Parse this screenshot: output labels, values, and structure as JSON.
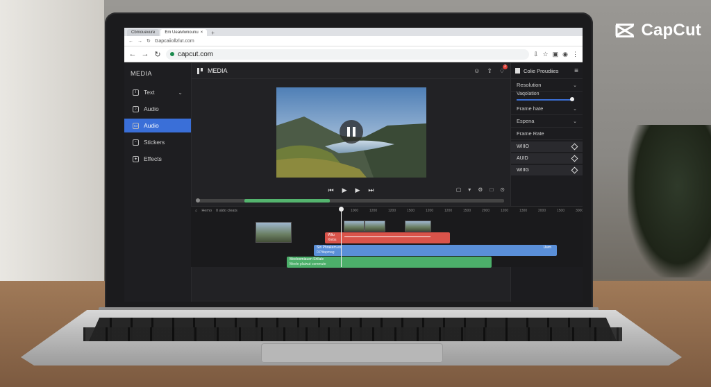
{
  "brand": {
    "name": "CapCut"
  },
  "browser": {
    "tabs": [
      {
        "label": "Cbmouevure"
      },
      {
        "label": "Em Ueaivlwnounu"
      }
    ],
    "url": "capcut.com",
    "second_bar_text": "Gapcaiiollzlut.com"
  },
  "left_panel": {
    "title": "MEDIA",
    "items": [
      {
        "label": "Text",
        "icon": "text-icon",
        "active": false
      },
      {
        "label": "Audio",
        "icon": "audio-icon",
        "active": false
      },
      {
        "label": "Audio",
        "icon": "audio-icon",
        "active": true
      },
      {
        "label": "Stickers",
        "icon": "stickers-icon",
        "active": false
      },
      {
        "label": "Effects",
        "icon": "effects-icon",
        "active": false
      }
    ]
  },
  "center": {
    "title": "MEDIA",
    "notification_count": "2"
  },
  "right_panel": {
    "title": "Colie Proudiies",
    "rows": [
      {
        "label": "Resolution"
      },
      {
        "label": "Vaqolation"
      },
      {
        "label": "Frame hate"
      },
      {
        "label": "Espena"
      },
      {
        "label": "Frame Rate"
      }
    ],
    "items": [
      {
        "label": "WIIIO"
      },
      {
        "label": "AUID"
      },
      {
        "label": "WIIIG"
      }
    ]
  },
  "timeline": {
    "head_left": "Hemo",
    "head_info": "0 aldo cleats",
    "ruler": [
      "1000",
      "1200",
      "1200",
      "1500",
      "1200",
      "1200",
      "1500",
      "2000",
      "1200",
      "1300",
      "2000",
      "1500",
      "3000",
      "3500"
    ],
    "clips": {
      "red": {
        "line1": "Wliu",
        "line2": "Xiebs"
      },
      "blue": {
        "line1": "Sin Phrakem.ex",
        "line2": "0.Pttapmag",
        "right": "Uwm"
      },
      "green": {
        "line1": "Meeloomiauen Shllale",
        "line2": "Meele plaiwut commute"
      }
    },
    "progress_fraction": 0.28
  }
}
